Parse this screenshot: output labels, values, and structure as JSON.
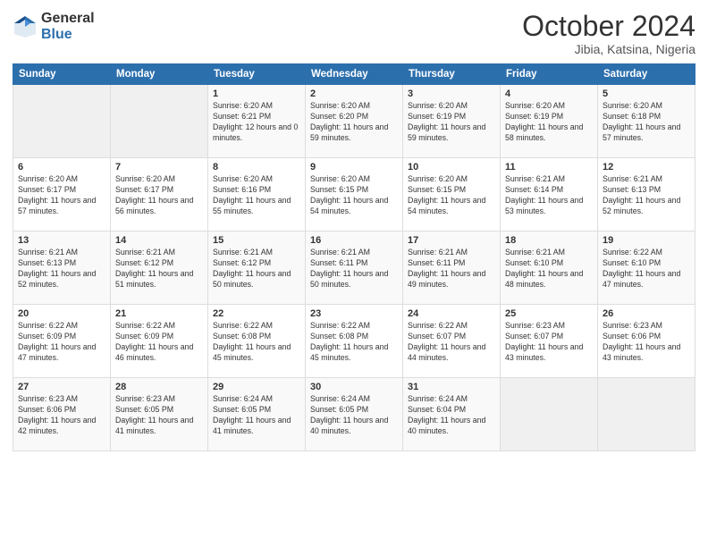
{
  "logo": {
    "general": "General",
    "blue": "Blue"
  },
  "title": "October 2024",
  "location": "Jibia, Katsina, Nigeria",
  "weekdays": [
    "Sunday",
    "Monday",
    "Tuesday",
    "Wednesday",
    "Thursday",
    "Friday",
    "Saturday"
  ],
  "weeks": [
    [
      {
        "day": "",
        "sunrise": "",
        "sunset": "",
        "daylight": ""
      },
      {
        "day": "",
        "sunrise": "",
        "sunset": "",
        "daylight": ""
      },
      {
        "day": "1",
        "sunrise": "Sunrise: 6:20 AM",
        "sunset": "Sunset: 6:21 PM",
        "daylight": "Daylight: 12 hours and 0 minutes."
      },
      {
        "day": "2",
        "sunrise": "Sunrise: 6:20 AM",
        "sunset": "Sunset: 6:20 PM",
        "daylight": "Daylight: 11 hours and 59 minutes."
      },
      {
        "day": "3",
        "sunrise": "Sunrise: 6:20 AM",
        "sunset": "Sunset: 6:19 PM",
        "daylight": "Daylight: 11 hours and 59 minutes."
      },
      {
        "day": "4",
        "sunrise": "Sunrise: 6:20 AM",
        "sunset": "Sunset: 6:19 PM",
        "daylight": "Daylight: 11 hours and 58 minutes."
      },
      {
        "day": "5",
        "sunrise": "Sunrise: 6:20 AM",
        "sunset": "Sunset: 6:18 PM",
        "daylight": "Daylight: 11 hours and 57 minutes."
      }
    ],
    [
      {
        "day": "6",
        "sunrise": "Sunrise: 6:20 AM",
        "sunset": "Sunset: 6:17 PM",
        "daylight": "Daylight: 11 hours and 57 minutes."
      },
      {
        "day": "7",
        "sunrise": "Sunrise: 6:20 AM",
        "sunset": "Sunset: 6:17 PM",
        "daylight": "Daylight: 11 hours and 56 minutes."
      },
      {
        "day": "8",
        "sunrise": "Sunrise: 6:20 AM",
        "sunset": "Sunset: 6:16 PM",
        "daylight": "Daylight: 11 hours and 55 minutes."
      },
      {
        "day": "9",
        "sunrise": "Sunrise: 6:20 AM",
        "sunset": "Sunset: 6:15 PM",
        "daylight": "Daylight: 11 hours and 54 minutes."
      },
      {
        "day": "10",
        "sunrise": "Sunrise: 6:20 AM",
        "sunset": "Sunset: 6:15 PM",
        "daylight": "Daylight: 11 hours and 54 minutes."
      },
      {
        "day": "11",
        "sunrise": "Sunrise: 6:21 AM",
        "sunset": "Sunset: 6:14 PM",
        "daylight": "Daylight: 11 hours and 53 minutes."
      },
      {
        "day": "12",
        "sunrise": "Sunrise: 6:21 AM",
        "sunset": "Sunset: 6:13 PM",
        "daylight": "Daylight: 11 hours and 52 minutes."
      }
    ],
    [
      {
        "day": "13",
        "sunrise": "Sunrise: 6:21 AM",
        "sunset": "Sunset: 6:13 PM",
        "daylight": "Daylight: 11 hours and 52 minutes."
      },
      {
        "day": "14",
        "sunrise": "Sunrise: 6:21 AM",
        "sunset": "Sunset: 6:12 PM",
        "daylight": "Daylight: 11 hours and 51 minutes."
      },
      {
        "day": "15",
        "sunrise": "Sunrise: 6:21 AM",
        "sunset": "Sunset: 6:12 PM",
        "daylight": "Daylight: 11 hours and 50 minutes."
      },
      {
        "day": "16",
        "sunrise": "Sunrise: 6:21 AM",
        "sunset": "Sunset: 6:11 PM",
        "daylight": "Daylight: 11 hours and 50 minutes."
      },
      {
        "day": "17",
        "sunrise": "Sunrise: 6:21 AM",
        "sunset": "Sunset: 6:11 PM",
        "daylight": "Daylight: 11 hours and 49 minutes."
      },
      {
        "day": "18",
        "sunrise": "Sunrise: 6:21 AM",
        "sunset": "Sunset: 6:10 PM",
        "daylight": "Daylight: 11 hours and 48 minutes."
      },
      {
        "day": "19",
        "sunrise": "Sunrise: 6:22 AM",
        "sunset": "Sunset: 6:10 PM",
        "daylight": "Daylight: 11 hours and 47 minutes."
      }
    ],
    [
      {
        "day": "20",
        "sunrise": "Sunrise: 6:22 AM",
        "sunset": "Sunset: 6:09 PM",
        "daylight": "Daylight: 11 hours and 47 minutes."
      },
      {
        "day": "21",
        "sunrise": "Sunrise: 6:22 AM",
        "sunset": "Sunset: 6:09 PM",
        "daylight": "Daylight: 11 hours and 46 minutes."
      },
      {
        "day": "22",
        "sunrise": "Sunrise: 6:22 AM",
        "sunset": "Sunset: 6:08 PM",
        "daylight": "Daylight: 11 hours and 45 minutes."
      },
      {
        "day": "23",
        "sunrise": "Sunrise: 6:22 AM",
        "sunset": "Sunset: 6:08 PM",
        "daylight": "Daylight: 11 hours and 45 minutes."
      },
      {
        "day": "24",
        "sunrise": "Sunrise: 6:22 AM",
        "sunset": "Sunset: 6:07 PM",
        "daylight": "Daylight: 11 hours and 44 minutes."
      },
      {
        "day": "25",
        "sunrise": "Sunrise: 6:23 AM",
        "sunset": "Sunset: 6:07 PM",
        "daylight": "Daylight: 11 hours and 43 minutes."
      },
      {
        "day": "26",
        "sunrise": "Sunrise: 6:23 AM",
        "sunset": "Sunset: 6:06 PM",
        "daylight": "Daylight: 11 hours and 43 minutes."
      }
    ],
    [
      {
        "day": "27",
        "sunrise": "Sunrise: 6:23 AM",
        "sunset": "Sunset: 6:06 PM",
        "daylight": "Daylight: 11 hours and 42 minutes."
      },
      {
        "day": "28",
        "sunrise": "Sunrise: 6:23 AM",
        "sunset": "Sunset: 6:05 PM",
        "daylight": "Daylight: 11 hours and 41 minutes."
      },
      {
        "day": "29",
        "sunrise": "Sunrise: 6:24 AM",
        "sunset": "Sunset: 6:05 PM",
        "daylight": "Daylight: 11 hours and 41 minutes."
      },
      {
        "day": "30",
        "sunrise": "Sunrise: 6:24 AM",
        "sunset": "Sunset: 6:05 PM",
        "daylight": "Daylight: 11 hours and 40 minutes."
      },
      {
        "day": "31",
        "sunrise": "Sunrise: 6:24 AM",
        "sunset": "Sunset: 6:04 PM",
        "daylight": "Daylight: 11 hours and 40 minutes."
      },
      {
        "day": "",
        "sunrise": "",
        "sunset": "",
        "daylight": ""
      },
      {
        "day": "",
        "sunrise": "",
        "sunset": "",
        "daylight": ""
      }
    ]
  ]
}
